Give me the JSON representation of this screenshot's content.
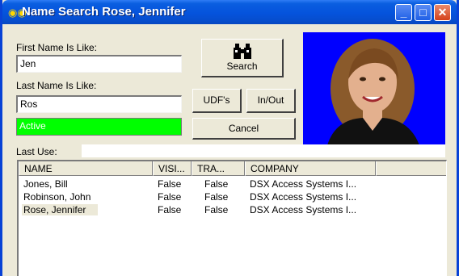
{
  "window": {
    "title": "Name Search  Rose, Jennifer",
    "icon": "binoculars-icon"
  },
  "form": {
    "first_name_label": "First Name Is Like:",
    "first_name_value": "Jen",
    "last_name_label": "Last Name Is Like:",
    "last_name_value": "Ros",
    "status_value": "Active",
    "status_color": "#00ff00",
    "last_use_label": "Last Use:",
    "last_use_value": ""
  },
  "buttons": {
    "search": "Search",
    "udfs": "UDF's",
    "inout": "In/Out",
    "cancel": "Cancel"
  },
  "table": {
    "columns": [
      "NAME",
      "VISI...",
      "TRA...",
      "COMPANY"
    ],
    "rows": [
      [
        "Jones, Bill",
        "False",
        "False",
        "DSX Access Systems I..."
      ],
      [
        "Robinson, John",
        "False",
        "False",
        "DSX Access Systems I..."
      ],
      [
        "Rose, Jennifer",
        "False",
        "False",
        "DSX Access Systems I..."
      ]
    ],
    "selected_row": 2
  },
  "colors": {
    "titlebar": "#0553dc",
    "photo_background": "#0000ff",
    "window_bg": "#ece9d8"
  }
}
